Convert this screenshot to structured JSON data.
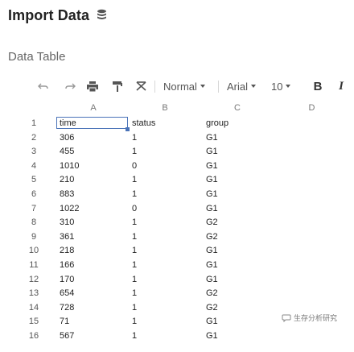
{
  "header": {
    "title": "Import Data",
    "icon": "database-icon"
  },
  "section": {
    "title": "Data Table"
  },
  "toolbar": {
    "undo_icon": "undo-icon",
    "redo_icon": "redo-icon",
    "print_icon": "print-icon",
    "paint_format_icon": "paint-format-icon",
    "clear_format_icon": "clear-format-icon",
    "style_label": "Normal",
    "font_label": "Arial",
    "size_label": "10",
    "bold_label": "B",
    "italic_label": "I"
  },
  "sheet": {
    "columns": [
      "A",
      "B",
      "C",
      "D"
    ],
    "rows": [
      {
        "n": "1",
        "a": "time",
        "b": "status",
        "c": "group"
      },
      {
        "n": "2",
        "a": "306",
        "b": "1",
        "c": "G1"
      },
      {
        "n": "3",
        "a": "455",
        "b": "1",
        "c": "G1"
      },
      {
        "n": "4",
        "a": "1010",
        "b": "0",
        "c": "G1"
      },
      {
        "n": "5",
        "a": "210",
        "b": "1",
        "c": "G1"
      },
      {
        "n": "6",
        "a": "883",
        "b": "1",
        "c": "G1"
      },
      {
        "n": "7",
        "a": "1022",
        "b": "0",
        "c": "G1"
      },
      {
        "n": "8",
        "a": "310",
        "b": "1",
        "c": "G2"
      },
      {
        "n": "9",
        "a": "361",
        "b": "1",
        "c": "G2"
      },
      {
        "n": "10",
        "a": "218",
        "b": "1",
        "c": "G1"
      },
      {
        "n": "11",
        "a": "166",
        "b": "1",
        "c": "G1"
      },
      {
        "n": "12",
        "a": "170",
        "b": "1",
        "c": "G1"
      },
      {
        "n": "13",
        "a": "654",
        "b": "1",
        "c": "G2"
      },
      {
        "n": "14",
        "a": "728",
        "b": "1",
        "c": "G2"
      },
      {
        "n": "15",
        "a": "71",
        "b": "1",
        "c": "G1"
      },
      {
        "n": "16",
        "a": "567",
        "b": "1",
        "c": "G1"
      }
    ]
  },
  "watermark": {
    "text": "生存分析研究"
  },
  "colors": {
    "selection": "#4a73b8",
    "header_text": "#777777"
  }
}
